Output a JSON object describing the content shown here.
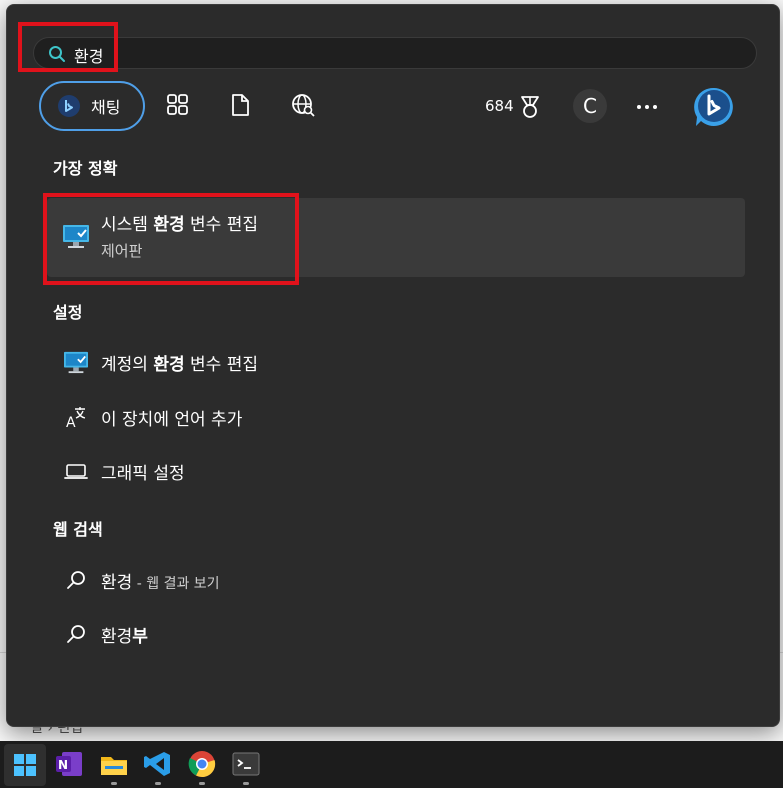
{
  "search": {
    "query": "환경"
  },
  "toolbar": {
    "chat_label": "채팅",
    "points": "684",
    "avatar_initial": "C"
  },
  "sections": {
    "best_match": "가장 정확",
    "settings": "설정",
    "web": "웹 검색"
  },
  "best_match": {
    "title_pre": "시스템 ",
    "title_bold": "환경",
    "title_post": " 변수 편집",
    "subtitle": "제어판"
  },
  "settings_items": [
    {
      "pre": "계정의 ",
      "bold": "환경",
      "post": " 변수 편집",
      "icon": "control-panel-icon"
    },
    {
      "pre": "이 장치에 언어 추가",
      "bold": "",
      "post": "",
      "icon": "language-icon"
    },
    {
      "pre": "그래픽 설정",
      "bold": "",
      "post": "",
      "icon": "laptop-icon"
    }
  ],
  "web_items": [
    {
      "pre": "환경",
      "bold": "",
      "suffix": " - 웹 결과 보기",
      "icon": "search-icon"
    },
    {
      "pre": "환경",
      "bold": "부",
      "suffix": "",
      "icon": "search-icon"
    }
  ],
  "background": {
    "crumb": "일  ›  편집"
  },
  "colors": {
    "panel": "#2b2b2b",
    "accent": "#4f9fe8",
    "highlight": "#e0121b"
  }
}
